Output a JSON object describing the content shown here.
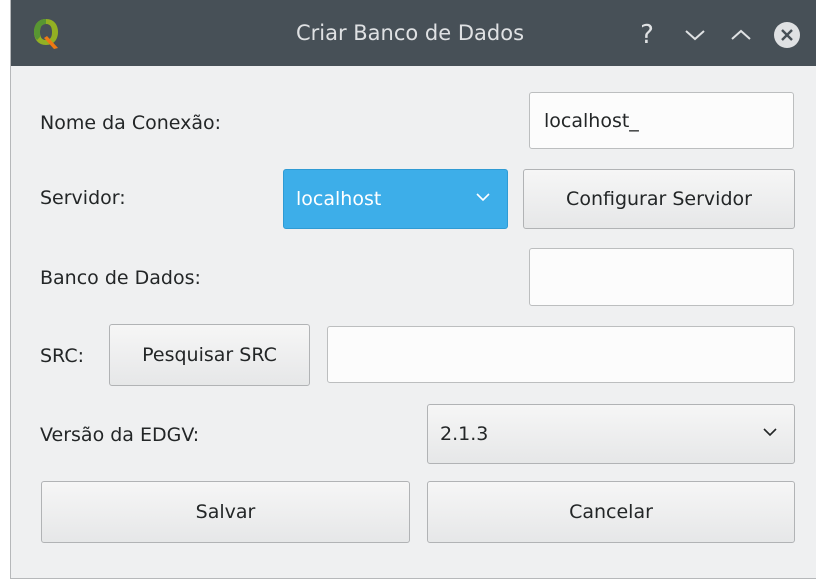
{
  "window": {
    "title": "Criar Banco de Dados",
    "help_glyph": "?"
  },
  "form": {
    "connection_label": "Nome da Conexão:",
    "connection_value": "localhost_",
    "server_label": "Servidor:",
    "server_selected": "localhost",
    "configure_server_label": "Configurar Servidor",
    "database_label": "Banco de Dados:",
    "database_value": "",
    "src_label": "SRC:",
    "search_src_label": "Pesquisar SRC",
    "src_value": "",
    "edgv_label": "Versão da EDGV:",
    "edgv_selected": "2.1.3"
  },
  "actions": {
    "save_label": "Salvar",
    "cancel_label": "Cancelar"
  },
  "colors": {
    "titlebar": "#475057",
    "accent": "#3daee9",
    "window_bg": "#eff0f1"
  },
  "icons": {
    "app": "qgis-icon",
    "minimize": "chevron-down-icon",
    "maximize": "chevron-up-icon",
    "close": "close-icon"
  }
}
